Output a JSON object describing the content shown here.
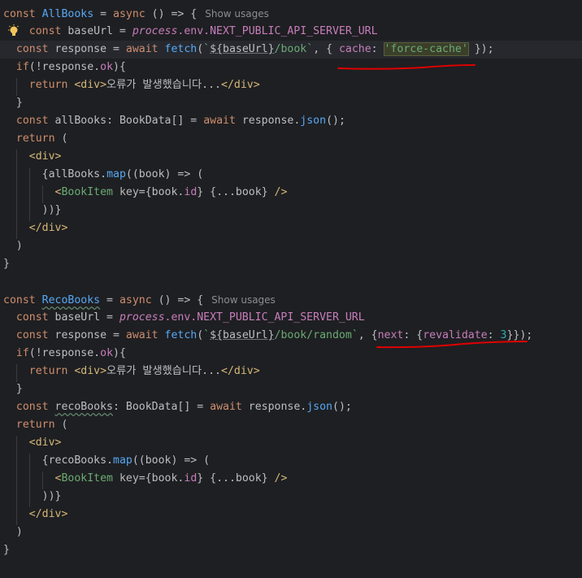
{
  "editor": {
    "hint_text": "Show usages",
    "block1": {
      "fn_name": "AllBooks",
      "fetch_path": "/book",
      "cache_key": "cache",
      "cache_value": "'force-cache'",
      "data_var": "allBooks",
      "error_text": "오류가 발생했습니다..."
    },
    "block2": {
      "fn_name": "RecoBooks",
      "fetch_path": "/book/random",
      "next_key": "next",
      "revalidate_key": "revalidate",
      "revalidate_value": "3",
      "data_var": "recoBooks",
      "error_text": "오류가 발생했습니다..."
    },
    "common": {
      "env_obj": "process",
      "env_path": ".env.NEXT_PUBLIC_API_SERVER_URL",
      "type_name": "BookData",
      "component": "BookItem",
      "json_fn": "json",
      "ok_prop": "ok",
      "map_fn": "map",
      "tpl_var": "${baseUrl}"
    }
  },
  "colors": {
    "background": "#1e1f22",
    "keyword": "#cf8e6d",
    "function": "#56a8f5",
    "string": "#6aab73",
    "annotation": "#e00000"
  }
}
